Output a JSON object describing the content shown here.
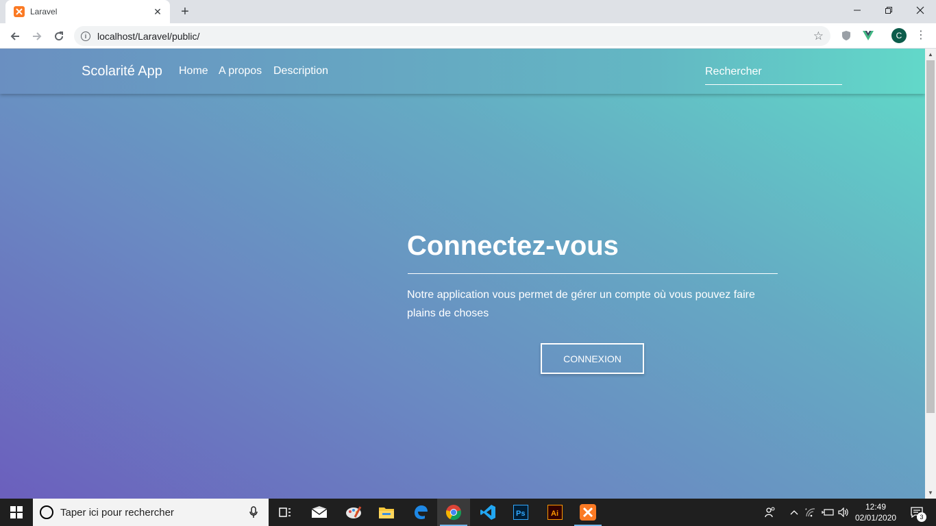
{
  "browser": {
    "tab": {
      "title": "Laravel",
      "favicon": "xampp-icon"
    },
    "new_tab_symbol": "+",
    "url": "localhost/Laravel/public/",
    "profile_initial": "C"
  },
  "page": {
    "navbar": {
      "brand": "Scolarité App",
      "links": [
        "Home",
        "A propos",
        "Description"
      ],
      "search_placeholder": "Rechercher"
    },
    "hero": {
      "title": "Connectez-vous",
      "text": "Notre application vous permet de gérer un compte où vous pouvez faire plains de choses",
      "button": "CONNEXION"
    },
    "colors": {
      "gradient_start": "#6b5fbd",
      "gradient_end": "#60dbc8"
    }
  },
  "taskbar": {
    "search_placeholder": "Taper ici pour rechercher",
    "apps": [
      "task-view-icon",
      "mail-icon",
      "paint-icon",
      "file-explorer-icon",
      "edge-icon",
      "chrome-icon",
      "vscode-icon",
      "photoshop-icon",
      "illustrator-icon",
      "xampp-icon"
    ],
    "clock_time": "12:49",
    "clock_date": "02/01/2020",
    "notification_count": "3"
  }
}
